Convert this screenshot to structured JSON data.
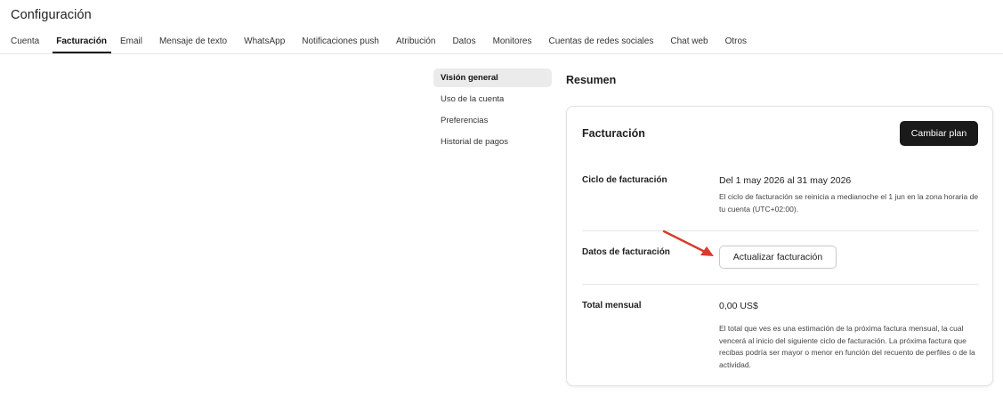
{
  "header": {
    "title": "Configuración"
  },
  "tabs": [
    {
      "label": "Cuenta",
      "active": false
    },
    {
      "label": "Facturación",
      "active": true
    },
    {
      "label": "Email",
      "active": false
    },
    {
      "label": "Mensaje de texto",
      "active": false
    },
    {
      "label": "WhatsApp",
      "active": false
    },
    {
      "label": "Notificaciones push",
      "active": false
    },
    {
      "label": "Atribución",
      "active": false
    },
    {
      "label": "Datos",
      "active": false
    },
    {
      "label": "Monitores",
      "active": false
    },
    {
      "label": "Cuentas de redes sociales",
      "active": false
    },
    {
      "label": "Chat web",
      "active": false
    },
    {
      "label": "Otros",
      "active": false
    }
  ],
  "subnav": [
    {
      "label": "Visión general",
      "active": true
    },
    {
      "label": "Uso de la cuenta",
      "active": false
    },
    {
      "label": "Preferencias",
      "active": false
    },
    {
      "label": "Historial de pagos",
      "active": false
    }
  ],
  "main": {
    "section_title": "Resumen",
    "card": {
      "title": "Facturación",
      "change_plan_label": "Cambiar plan",
      "billing_cycle": {
        "label": "Ciclo de facturación",
        "value": "Del 1 may 2026 al 31 may 2026",
        "description": "El ciclo de facturación se reinicia a medianoche el 1 jun en la zona horaria de tu cuenta (UTC+02:00)."
      },
      "billing_data": {
        "label": "Datos de facturación",
        "button_label": "Actualizar facturación"
      },
      "monthly_total": {
        "label": "Total mensual",
        "value": "0,00 US$",
        "description": "El total que ves es una estimación de la próxima factura mensual, la cual vencerá al inicio del siguiente ciclo de facturación. La próxima factura que recibas podría ser mayor o menor en función del recuento de perfiles o de la actividad."
      }
    }
  },
  "colors": {
    "annotation_arrow": "#d93a2b",
    "primary_button": "#1a1a1a",
    "active_subnav_bg": "#ebebeb"
  }
}
